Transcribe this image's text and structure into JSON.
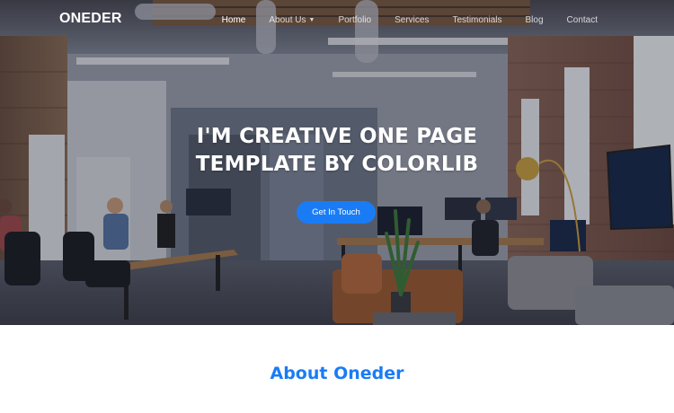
{
  "brand": {
    "name": "ONEDER"
  },
  "nav": {
    "items": [
      {
        "label": "Home",
        "active": true
      },
      {
        "label": "About Us",
        "dropdown": true
      },
      {
        "label": "Portfolio"
      },
      {
        "label": "Services"
      },
      {
        "label": "Testimonials"
      },
      {
        "label": "Blog"
      },
      {
        "label": "Contact"
      }
    ]
  },
  "hero": {
    "title_line1": "I'M CREATIVE ONE PAGE",
    "title_line2": "TEMPLATE BY COLORLIB",
    "cta_label": "Get In Touch"
  },
  "about": {
    "title": "About Oneder"
  },
  "colors": {
    "accent": "#1a7cf5",
    "text_light": "#ffffff"
  }
}
